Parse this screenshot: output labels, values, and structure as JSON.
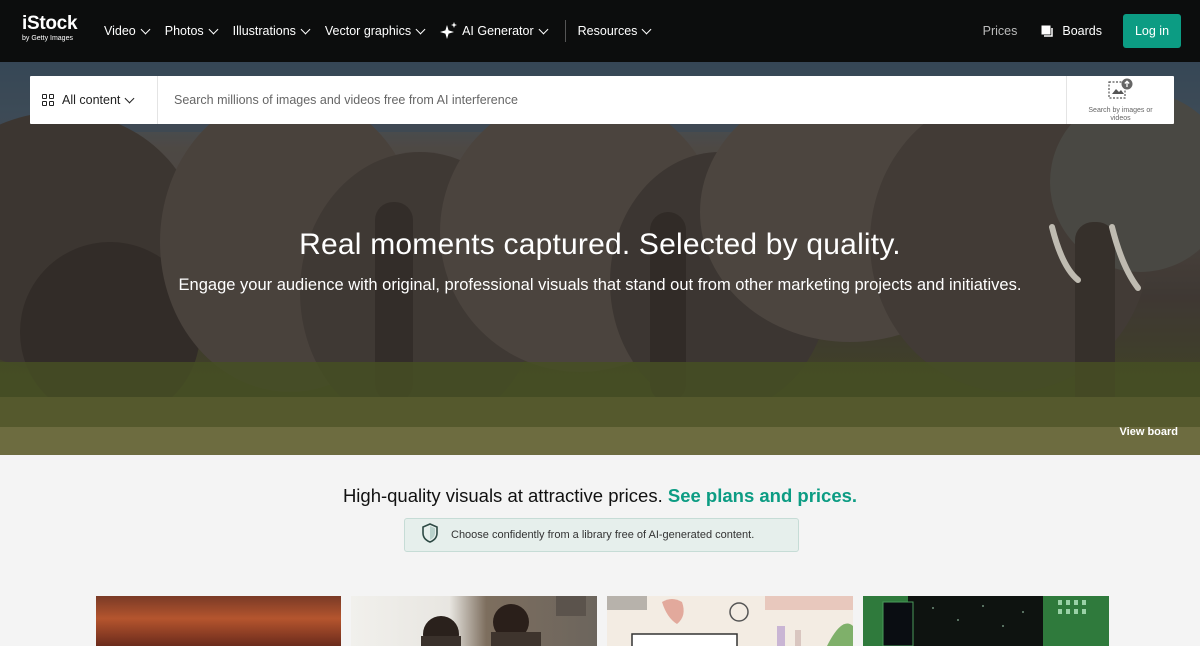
{
  "nav": {
    "logo_main": "iStock",
    "logo_sub": "by Getty Images",
    "menu": [
      {
        "label": "Video"
      },
      {
        "label": "Photos"
      },
      {
        "label": "Illustrations"
      },
      {
        "label": "Vector graphics"
      },
      {
        "label": "AI Generator"
      },
      {
        "label": "Resources"
      }
    ],
    "prices": "Prices",
    "boards": "Boards",
    "login": "Log in",
    "login_color": "#0c9c83"
  },
  "search": {
    "content_type": "All content",
    "placeholder": "Search millions of images and videos free from AI interference",
    "visual_search_label": "Search by images or videos"
  },
  "hero": {
    "title": "Real moments captured. Selected by quality.",
    "subtitle": "Engage your audience with original, professional visuals that stand out from other marketing projects and initiatives.",
    "view_board": "View board"
  },
  "promo": {
    "text": "High-quality visuals at attractive prices.",
    "link": "See plans and prices."
  },
  "ai_banner": {
    "text": "Choose confidently from a library free of AI-generated content.",
    "icon": "shield-icon"
  },
  "accent_color": "#0c9c83"
}
